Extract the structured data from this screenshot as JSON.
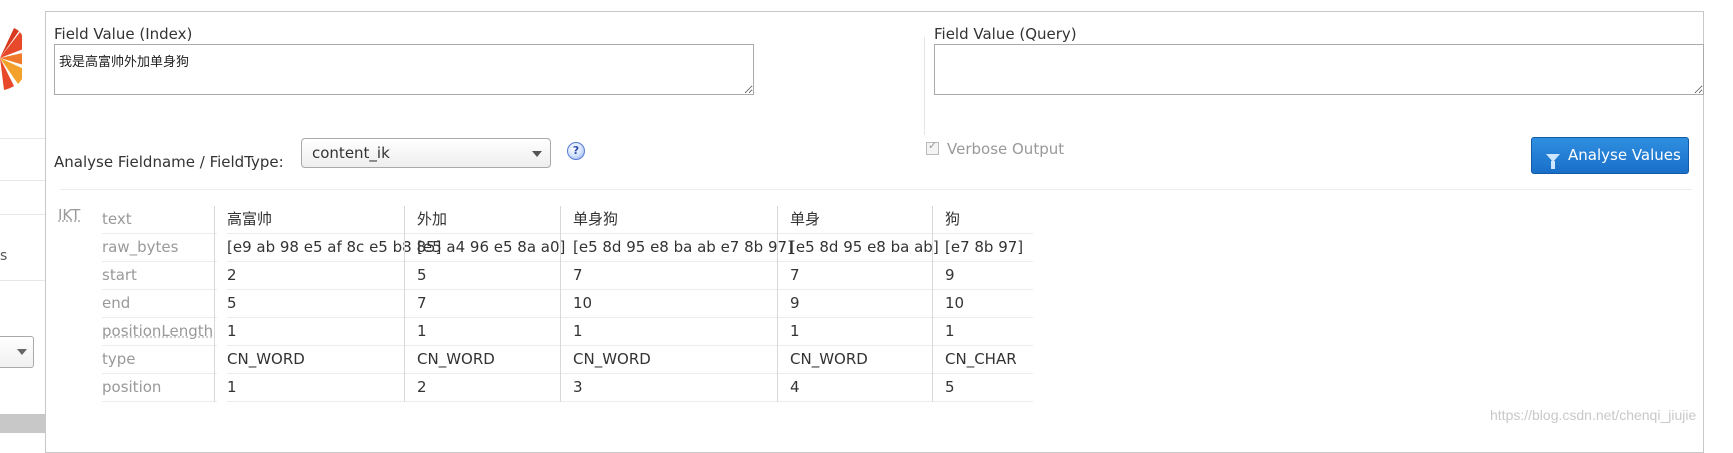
{
  "index_field": {
    "label": "Field Value (Index)",
    "value": "我是高富帅外加单身狗"
  },
  "query_field": {
    "label": "Field Value (Query)",
    "value": ""
  },
  "fieldtype": {
    "label": "Analyse Fieldname / FieldType:",
    "selected": "content_ik",
    "help": "?"
  },
  "verbose": {
    "label": "Verbose Output",
    "checked": true
  },
  "analyse_button": {
    "label": "Analyse Values",
    "icon": "funnel-icon"
  },
  "results": {
    "stage": "IKT",
    "attributes": [
      "text",
      "raw_bytes",
      "start",
      "end",
      "positionLength",
      "type",
      "position"
    ],
    "tokens": [
      {
        "text": "高富帅",
        "raw_bytes": "[e9 ab 98 e5 af 8c e5 b8 85]",
        "start": "2",
        "end": "5",
        "positionLength": "1",
        "type": "CN_WORD",
        "position": "1"
      },
      {
        "text": "外加",
        "raw_bytes": "[e5 a4 96 e5 8a a0]",
        "start": "5",
        "end": "7",
        "positionLength": "1",
        "type": "CN_WORD",
        "position": "2"
      },
      {
        "text": "单身狗",
        "raw_bytes": "[e5 8d 95 e8 ba ab e7 8b 97]",
        "start": "7",
        "end": "10",
        "positionLength": "1",
        "type": "CN_WORD",
        "position": "3"
      },
      {
        "text": "单身",
        "raw_bytes": "[e5 8d 95 e8 ba ab]",
        "start": "7",
        "end": "9",
        "positionLength": "1",
        "type": "CN_WORD",
        "position": "4"
      },
      {
        "text": "狗",
        "raw_bytes": "[e7 8b 97]",
        "start": "9",
        "end": "10",
        "positionLength": "1",
        "type": "CN_CHAR",
        "position": "5"
      }
    ]
  },
  "sidebar": {
    "partial_text": "s"
  },
  "watermark": "https://blog.csdn.net/chenqi_jiujie",
  "colors": {
    "button": "#1a6fc9",
    "border": "#c8c8c8"
  }
}
